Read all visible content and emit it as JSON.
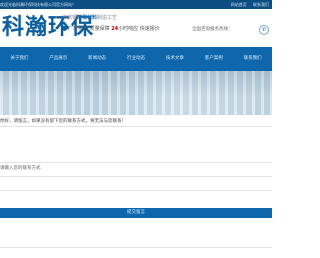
{
  "topbar": {
    "notice": "欢迎光临科瀚环保科技有限公司官方网站！",
    "links": [
      "网站首页",
      "联系我们"
    ]
  },
  "header": {
    "logo": "科瀚环保",
    "slogan_line1_prefix": "不锈钢",
    "slogan_line1_highlight": "环保材料",
    "slogan_line1_suffix": "制造工艺",
    "slogan_line2_a": "厂家实力 质量保障",
    "slogan_line2_num": "24",
    "slogan_line2_b": "小时响应 快速报价",
    "hotline": "全国咨询服务热线：",
    "hotline_icon": "phone-icon"
  },
  "nav": {
    "items": [
      "关于我们",
      "产品展示",
      "新闻动态",
      "行业动态",
      "技术文章",
      "客户案例",
      "联系我们"
    ]
  },
  "message": {
    "intro": "你好，请留言，如果没有留下您的联系方式，将无法与您联系！",
    "fields": [
      "",
      "请输入您的联系方式",
      "",
      ""
    ],
    "submit": "提交留言"
  },
  "colors": {
    "topbar": "#0d4e82",
    "nav": "#0e67ad",
    "logo": "#0e5e9e"
  }
}
